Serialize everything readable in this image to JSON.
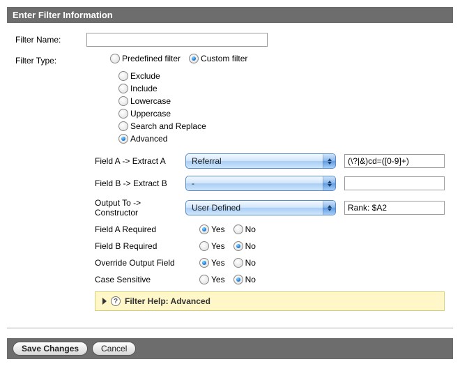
{
  "header": {
    "title": "Enter Filter Information"
  },
  "form": {
    "filterNameLabel": "Filter Name:",
    "filterNameValue": "",
    "filterTypeLabel": "Filter Type:",
    "predefinedLabel": "Predefined filter",
    "customLabel": "Custom filter",
    "filterTypeSelected": "custom",
    "modes": [
      {
        "label": "Exclude",
        "selected": false
      },
      {
        "label": "Include",
        "selected": false
      },
      {
        "label": "Lowercase",
        "selected": false
      },
      {
        "label": "Uppercase",
        "selected": false
      },
      {
        "label": "Search and Replace",
        "selected": false
      },
      {
        "label": "Advanced",
        "selected": true
      }
    ],
    "fieldA": {
      "label": "Field A -> Extract A",
      "select": "Referral",
      "value": "(\\?|&)cd=([0-9]+)"
    },
    "fieldB": {
      "label": "Field B -> Extract B",
      "select": "-",
      "value": ""
    },
    "output": {
      "label": "Output To -> Constructor",
      "select": "User Defined",
      "value": "Rank: $A2"
    },
    "yesLabel": "Yes",
    "noLabel": "No",
    "fieldAReq": {
      "label": "Field A Required",
      "value": "yes"
    },
    "fieldBReq": {
      "label": "Field B Required",
      "value": "no"
    },
    "override": {
      "label": "Override Output Field",
      "value": "yes"
    },
    "caseSens": {
      "label": "Case Sensitive",
      "value": "no"
    }
  },
  "help": {
    "label": "Filter Help: Advanced"
  },
  "footer": {
    "save": "Save Changes",
    "cancel": "Cancel"
  }
}
